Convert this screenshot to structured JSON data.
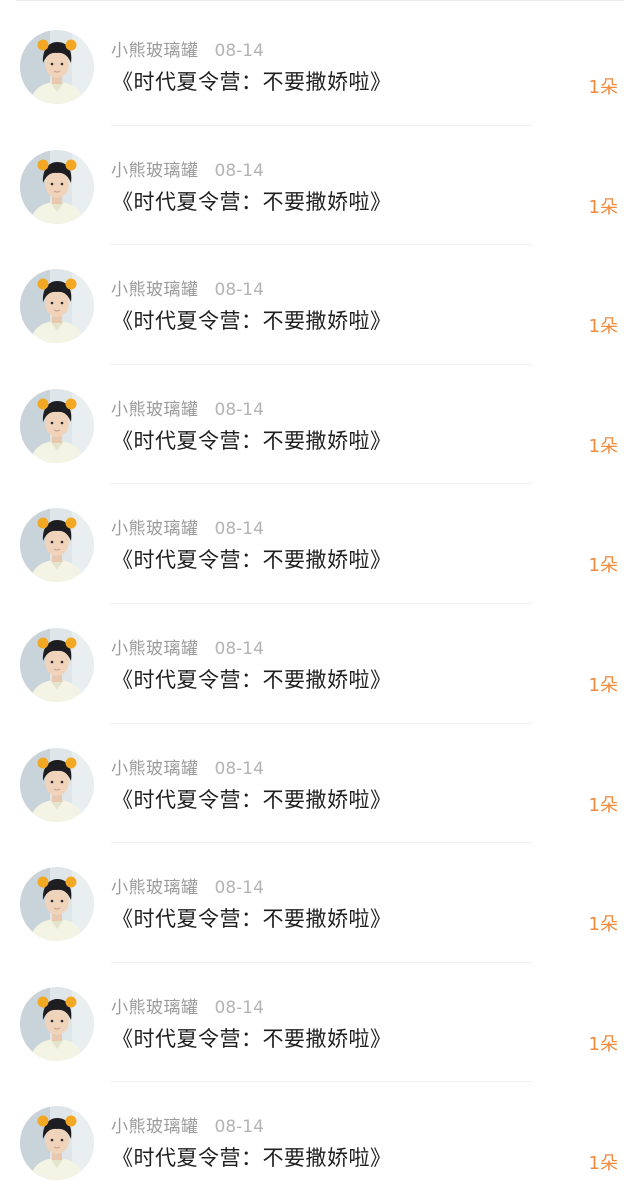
{
  "accent_color": "#f08a3c",
  "gifts": [
    {
      "user": "小熊玻璃罐",
      "date": "08-14",
      "title": "《时代夏令营：不要撒娇啦》",
      "count": "1朵",
      "avatar_icon": "user-avatar-photo"
    },
    {
      "user": "小熊玻璃罐",
      "date": "08-14",
      "title": "《时代夏令营：不要撒娇啦》",
      "count": "1朵",
      "avatar_icon": "user-avatar-photo"
    },
    {
      "user": "小熊玻璃罐",
      "date": "08-14",
      "title": "《时代夏令营：不要撒娇啦》",
      "count": "1朵",
      "avatar_icon": "user-avatar-photo"
    },
    {
      "user": "小熊玻璃罐",
      "date": "08-14",
      "title": "《时代夏令营：不要撒娇啦》",
      "count": "1朵",
      "avatar_icon": "user-avatar-photo"
    },
    {
      "user": "小熊玻璃罐",
      "date": "08-14",
      "title": "《时代夏令营：不要撒娇啦》",
      "count": "1朵",
      "avatar_icon": "user-avatar-photo"
    },
    {
      "user": "小熊玻璃罐",
      "date": "08-14",
      "title": "《时代夏令营：不要撒娇啦》",
      "count": "1朵",
      "avatar_icon": "user-avatar-photo"
    },
    {
      "user": "小熊玻璃罐",
      "date": "08-14",
      "title": "《时代夏令营：不要撒娇啦》",
      "count": "1朵",
      "avatar_icon": "user-avatar-photo"
    },
    {
      "user": "小熊玻璃罐",
      "date": "08-14",
      "title": "《时代夏令营：不要撒娇啦》",
      "count": "1朵",
      "avatar_icon": "user-avatar-photo"
    },
    {
      "user": "小熊玻璃罐",
      "date": "08-14",
      "title": "《时代夏令营：不要撒娇啦》",
      "count": "1朵",
      "avatar_icon": "user-avatar-photo"
    },
    {
      "user": "小熊玻璃罐",
      "date": "08-14",
      "title": "《时代夏令营：不要撒娇啦》",
      "count": "1朵",
      "avatar_icon": "user-avatar-photo"
    }
  ]
}
